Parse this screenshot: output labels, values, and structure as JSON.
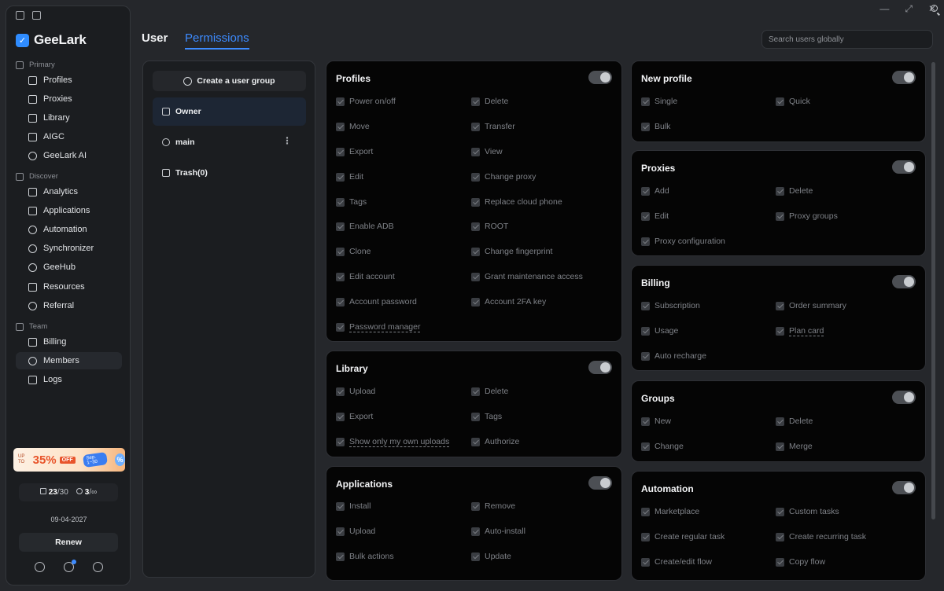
{
  "sidebar": {
    "logo_text": "GeeLark",
    "sections": {
      "primary": "Primary",
      "discover": "Discover",
      "team": "Team"
    },
    "items": {
      "profiles": "Profiles",
      "proxies": "Proxies",
      "library": "Library",
      "aigc": "AIGC",
      "geelark_ai": "GeeLark AI",
      "analytics": "Analytics",
      "applications": "Applications",
      "automation": "Automation",
      "synchronizer": "Synchronizer",
      "geehub": "GeeHub",
      "resources": "Resources",
      "referral": "Referral",
      "billing": "Billing",
      "members": "Members",
      "logs": "Logs"
    },
    "promo": {
      "up_to": "UP TO",
      "percent": "35%",
      "off": "OFF",
      "dates": "Sep. 1~30",
      "badge": "%"
    },
    "quota": {
      "profiles_used": "23",
      "profiles_total": "/30",
      "members_used": "3",
      "members_total": "/∞"
    },
    "expiry": "09-04-2027",
    "renew_label": "Renew"
  },
  "window": {
    "minimize": "—",
    "maximize": "⤢",
    "close": "✕"
  },
  "header": {
    "tab_user": "User",
    "tab_permissions": "Permissions",
    "search_placeholder": "Search users globally"
  },
  "groups": {
    "create_label": "Create a user group",
    "items": [
      "Owner",
      "main",
      "Trash(0)"
    ],
    "more": "⋮"
  },
  "cards": {
    "profiles": {
      "title": "Profiles",
      "perms": [
        "Power on/off",
        "Delete",
        "Move",
        "Transfer",
        "Export",
        "View",
        "Edit",
        "Change proxy",
        "Tags",
        "Replace cloud phone",
        "Enable ADB",
        "ROOT",
        "Clone",
        "Change fingerprint",
        "Edit account",
        "Grant maintenance access",
        "Account password",
        "Account 2FA key",
        "Password manager"
      ]
    },
    "library": {
      "title": "Library",
      "perms": [
        "Upload",
        "Delete",
        "Export",
        "Tags",
        "Show only my own uploads",
        "Authorize"
      ]
    },
    "applications": {
      "title": "Applications",
      "perms": [
        "Install",
        "Remove",
        "Upload",
        "Auto-install",
        "Bulk actions",
        "Update"
      ]
    },
    "new_profile": {
      "title": "New profile",
      "perms": [
        "Single",
        "Quick",
        "Bulk"
      ]
    },
    "proxies": {
      "title": "Proxies",
      "perms": [
        "Add",
        "Delete",
        "Edit",
        "Proxy groups",
        "Proxy configuration"
      ]
    },
    "billing": {
      "title": "Billing",
      "perms": [
        "Subscription",
        "Order summary",
        "Usage",
        "Plan card",
        "Auto recharge"
      ]
    },
    "groups_card": {
      "title": "Groups",
      "perms": [
        "New",
        "Delete",
        "Change",
        "Merge"
      ]
    },
    "automation": {
      "title": "Automation",
      "perms": [
        "Marketplace",
        "Custom tasks",
        "Create regular task",
        "Create recurring task",
        "Create/edit flow",
        "Copy flow"
      ]
    }
  }
}
